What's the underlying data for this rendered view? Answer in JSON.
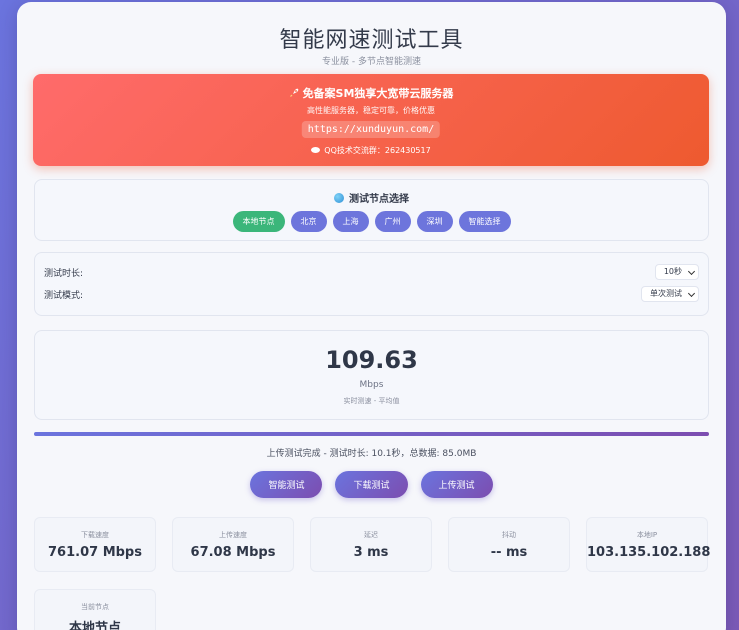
{
  "header": {
    "title": "智能网速测试工具",
    "subtitle": "专业版 - 多节点智能测速"
  },
  "promo": {
    "title": "免备案SM独享大宽带云服务器",
    "desc": "高性能服务器，稳定可靠，价格优惠",
    "link": "https://xunduyun.com/",
    "qq": "QQ技术交流群：262430517",
    "rocket_icon": "rocket-icon",
    "chat_icon": "chat-icon"
  },
  "nodes": {
    "title": "测试节点选择",
    "items": [
      {
        "label": "本地节点",
        "active": true
      },
      {
        "label": "北京",
        "active": false
      },
      {
        "label": "上海",
        "active": false
      },
      {
        "label": "广州",
        "active": false
      },
      {
        "label": "深圳",
        "active": false
      },
      {
        "label": "智能选择",
        "active": false
      }
    ]
  },
  "settings": {
    "duration_label": "测试时长:",
    "duration_value": "10秒",
    "mode_label": "测试模式:",
    "mode_value": "单次测试"
  },
  "speed": {
    "value": "109.63",
    "unit": "Mbps",
    "note": "实时测速 - 平均值"
  },
  "progress": {
    "percent": 100
  },
  "status": "上传测试完成 - 测试时长: 10.1秒，总数据: 85.0MB",
  "actions": {
    "smart": "智能测试",
    "download": "下载测试",
    "upload": "上传测试"
  },
  "stats": {
    "download": {
      "label": "下载速度",
      "value": "761.07 Mbps"
    },
    "upload": {
      "label": "上传速度",
      "value": "67.08 Mbps"
    },
    "latency": {
      "label": "延迟",
      "value": "3 ms"
    },
    "jitter": {
      "label": "抖动",
      "value": "-- ms"
    },
    "ip": {
      "label": "本地IP",
      "value": "103.135.102.188"
    },
    "node": {
      "label": "当前节点",
      "value": "本地节点"
    }
  },
  "colors": {
    "accent": "#6d75dc",
    "active_node": "#3bb67a",
    "promo": "#ee5a2f"
  }
}
